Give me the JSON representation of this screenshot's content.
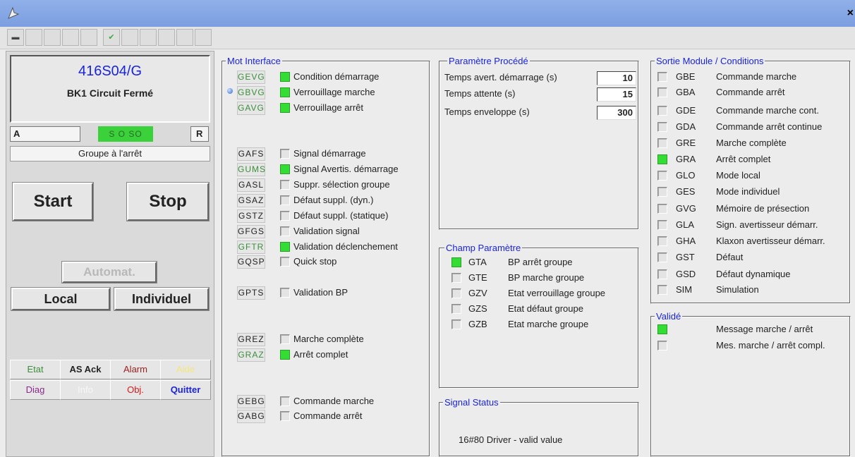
{
  "colors": {
    "titlebar": "#7c9ee0",
    "accent_blue": "#1a24d8",
    "active_green": "#33dd33",
    "tag_green": "#3b8e3b"
  },
  "titlebar": {
    "app_icon": "plane-icon",
    "close": "×"
  },
  "toolbar": {
    "icons": [
      "minimize-window-icon",
      "check-icon"
    ]
  },
  "left": {
    "id": "416S04/G",
    "name": "BK1 Circuit Fermé",
    "a_label": "A",
    "status_flags": "S O SO",
    "r_label": "R",
    "state": "Groupe à l'arrêt",
    "start": "Start",
    "stop": "Stop",
    "automat": "Automat.",
    "local": "Local",
    "individuel": "Individuel",
    "nav": [
      {
        "label": "Etat",
        "color": "#3b8e3b"
      },
      {
        "label": "AS Ack",
        "color": "#222222"
      },
      {
        "label": "Alarm",
        "color": "#9a2020"
      },
      {
        "label": "Aide",
        "color": "#f4e67a"
      },
      {
        "label": "Diag",
        "color": "#8a2a8a"
      },
      {
        "label": "Info",
        "color": "#f7f7f7"
      },
      {
        "label": "Obj.",
        "color": "#d81a1a"
      },
      {
        "label": "Quitter",
        "color": "#1a24d8"
      }
    ]
  },
  "mot_interface": {
    "title": "Mot Interface",
    "items": [
      {
        "tag": "GEVG",
        "tag_color": "g",
        "on": true,
        "label": "Condition démarrage"
      },
      {
        "tag": "GBVG",
        "tag_color": "g",
        "on": true,
        "label": "Verrouillage marche"
      },
      {
        "tag": "GAVG",
        "tag_color": "g",
        "on": true,
        "label": "Verrouillage arrêt"
      },
      {
        "tag": "GAFS",
        "tag_color": "k",
        "on": false,
        "label": "Signal démarrage"
      },
      {
        "tag": "GUMS",
        "tag_color": "g",
        "on": true,
        "label": "Signal Avertis. démarrage"
      },
      {
        "tag": "GASL",
        "tag_color": "k",
        "on": false,
        "label": "Suppr. sélection groupe"
      },
      {
        "tag": "GSAZ",
        "tag_color": "k",
        "on": false,
        "label": "Défaut suppl. (dyn.)"
      },
      {
        "tag": "GSTZ",
        "tag_color": "k",
        "on": false,
        "label": "Défaut suppl. (statique)"
      },
      {
        "tag": "GFGS",
        "tag_color": "k",
        "on": false,
        "label": "Validation signal"
      },
      {
        "tag": "GFTR",
        "tag_color": "g",
        "on": true,
        "label": "Validation déclenchement"
      },
      {
        "tag": "GQSP",
        "tag_color": "k",
        "on": false,
        "label": "Quick stop"
      },
      {
        "tag": "GPTS",
        "tag_color": "k",
        "on": false,
        "label": "Validation BP"
      },
      {
        "tag": "GREZ",
        "tag_color": "k",
        "on": false,
        "label": "Marche complète"
      },
      {
        "tag": "GRAZ",
        "tag_color": "g",
        "on": true,
        "label": "Arrêt complet"
      },
      {
        "tag": "GEBG",
        "tag_color": "k",
        "on": false,
        "label": "Commande marche"
      },
      {
        "tag": "GABG",
        "tag_color": "k",
        "on": false,
        "label": "Commande arrêt"
      }
    ]
  },
  "parametre_procede": {
    "title": "Paramètre Procédé",
    "rows": [
      {
        "label": "Temps avert. démarrage (s)",
        "value": "10"
      },
      {
        "label": "Temps attente (s)",
        "value": "15"
      },
      {
        "label": "Temps enveloppe (s)",
        "value": "300"
      }
    ]
  },
  "champ_parametre": {
    "title": "Champ Paramètre",
    "items": [
      {
        "code": "GTA",
        "on": true,
        "label": "BP arrêt groupe"
      },
      {
        "code": "GTE",
        "on": false,
        "label": "BP marche groupe"
      },
      {
        "code": "GZV",
        "on": false,
        "label": "Etat verrouillage groupe"
      },
      {
        "code": "GZS",
        "on": false,
        "label": "Etat défaut groupe"
      },
      {
        "code": "GZB",
        "on": false,
        "label": "Etat marche groupe"
      }
    ]
  },
  "signal_status": {
    "title": "Signal Status",
    "value": "16#80  Driver - valid value"
  },
  "sortie_module": {
    "title": "Sortie Module  / Conditions",
    "items": [
      {
        "code": "GBE",
        "on": false,
        "label": "Commande marche"
      },
      {
        "code": "GBA",
        "on": false,
        "label": "Commande arrêt"
      },
      {
        "code": "GDE",
        "on": false,
        "label": "Commande marche cont."
      },
      {
        "code": "GDA",
        "on": false,
        "label": "Commande arrêt continue"
      },
      {
        "code": "GRE",
        "on": false,
        "label": "Marche complète"
      },
      {
        "code": "GRA",
        "on": true,
        "label": "Arrêt complet"
      },
      {
        "code": "GLO",
        "on": false,
        "label": "Mode local"
      },
      {
        "code": "GES",
        "on": false,
        "label": "Mode individuel"
      },
      {
        "code": "GVG",
        "on": false,
        "label": "Mémoire de présection"
      },
      {
        "code": "GLA",
        "on": false,
        "label": "Sign. avertisseur démarr."
      },
      {
        "code": "GHA",
        "on": false,
        "label": "Klaxon avertisseur démarr."
      },
      {
        "code": "GST",
        "on": false,
        "label": "Défaut"
      },
      {
        "code": "GSD",
        "on": false,
        "label": "Défaut dynamique"
      },
      {
        "code": "SIM",
        "on": false,
        "label": "Simulation"
      }
    ]
  },
  "valide": {
    "title": "Validé",
    "items": [
      {
        "on": true,
        "label": "Message marche / arrêt"
      },
      {
        "on": false,
        "label": "Mes. marche / arrêt compl."
      }
    ]
  }
}
